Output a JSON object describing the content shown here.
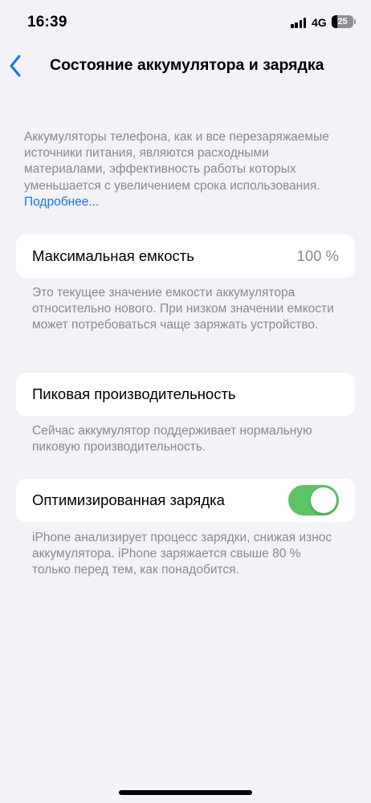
{
  "status_bar": {
    "time": "16:39",
    "network": "4G",
    "battery_level": "25",
    "battery_fraction": 0.25
  },
  "nav": {
    "back_icon": "chevron-left-icon",
    "title": "Состояние аккумулятора и зарядка"
  },
  "intro": {
    "text": "Аккумуляторы телефона, как и все перезаряжаемые источники питания, являются расходными материалами, эффективность работы которых уменьшается с увеличением срока использования. ",
    "link": "Подробнее..."
  },
  "max_capacity": {
    "label": "Максимальная емкость",
    "value": "100 %",
    "footnote": "Это текущее значение емкости аккумулятора относительно нового. При низком значении емкости может потребоваться чаще заряжать устройство."
  },
  "peak_performance": {
    "label": "Пиковая производительность",
    "footnote": "Сейчас аккумулятор поддерживает нормальную пиковую производительность."
  },
  "optimized_charging": {
    "label": "Оптимизированная зарядка",
    "enabled": true,
    "footnote": "iPhone анализирует процесс зарядки, снижая износ аккумулятора. iPhone заряжается свыше 80 % только перед тем, как понадобится."
  },
  "colors": {
    "background": "#f2f2f7",
    "accent": "#1a73e8",
    "toggle_on": "#5ac466",
    "secondary_text": "#8a8a8e"
  }
}
